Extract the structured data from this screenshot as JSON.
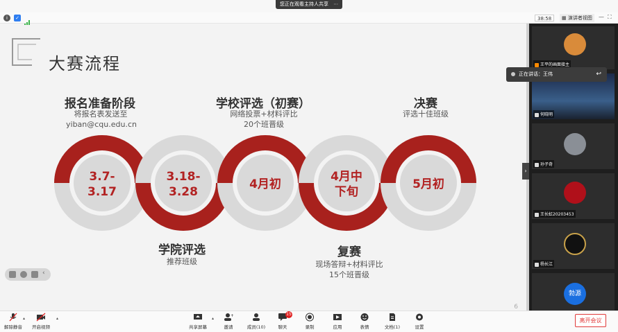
{
  "share_bar": {
    "label": "您正在观看主持人共享",
    "end": "⋯"
  },
  "toolbar": {
    "timer": "38:58",
    "view_label": "演讲者视图"
  },
  "slide": {
    "title": "大赛流程",
    "page": "6",
    "stages": [
      {
        "head": "报名准备阶段",
        "sub1": "将报名表发送至",
        "sub2": "yiban@cqu.edu.cn",
        "circle": [
          "3.7-",
          "3.17"
        ]
      },
      {
        "head": "学院评选",
        "sub1": "推荐班级",
        "sub2": "",
        "circle": [
          "3.18-",
          "3.28"
        ]
      },
      {
        "head": "学校评选（初赛）",
        "sub1": "网络投票+材料评比",
        "sub2": "20个班晋级",
        "circle": [
          "4月初"
        ]
      },
      {
        "head": "复赛",
        "sub1": "现场答辩+材料评比",
        "sub2": "15个班晋级",
        "circle": [
          "4月中",
          "下旬"
        ]
      },
      {
        "head": "决赛",
        "sub1": "评选十佳班级",
        "sub2": "",
        "circle": [
          "5月初"
        ]
      }
    ]
  },
  "speaking": {
    "label": "正在讲话：王伟"
  },
  "participants": [
    {
      "name": "王平的画面接主"
    },
    {
      "name": "何晓明"
    },
    {
      "name": "孙子奇"
    },
    {
      "name": "王长虹20203453"
    },
    {
      "name": "杨长江"
    },
    {
      "name": "勃源"
    }
  ],
  "bottom": {
    "items": [
      {
        "label": "解除静音"
      },
      {
        "label": "开启视频"
      },
      {
        "label": "共享屏幕"
      },
      {
        "label": "邀请"
      },
      {
        "label": "成员(10)"
      },
      {
        "label": "聊天"
      },
      {
        "label": "录制"
      },
      {
        "label": "应用"
      },
      {
        "label": "表情"
      },
      {
        "label": "文档(1)"
      },
      {
        "label": "设置"
      }
    ],
    "chat_badge": "15",
    "leave": "离开会议"
  },
  "colors": {
    "accent_red": "#a8211d",
    "ring_gray": "#d9d9d9"
  }
}
